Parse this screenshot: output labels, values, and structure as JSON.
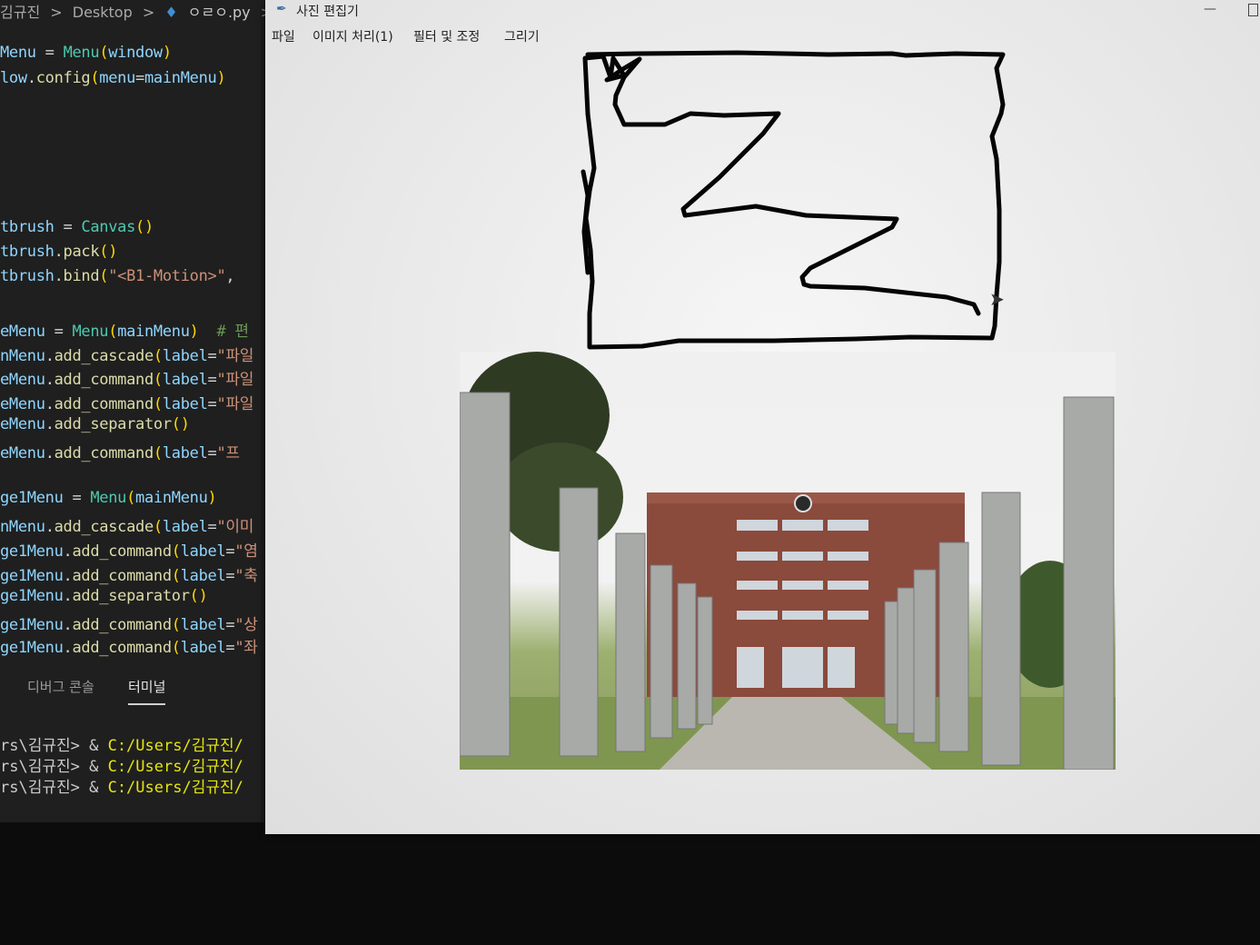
{
  "editor": {
    "breadcrumb": [
      "김규진",
      "Desktop",
      "ㅇㄹㅇ.py"
    ],
    "breadcrumb_sep": ">",
    "code": [
      {
        "tokens": [
          [
            "v",
            "Menu"
          ],
          [
            "t",
            " = "
          ],
          [
            "c",
            "Menu"
          ],
          [
            "p",
            "("
          ],
          [
            "v",
            "window"
          ],
          [
            "p",
            ")"
          ]
        ]
      },
      {
        "tokens": [
          [
            "v",
            "low"
          ],
          [
            "t",
            "."
          ],
          [
            "f",
            "config"
          ],
          [
            "p",
            "("
          ],
          [
            "v",
            "menu"
          ],
          [
            "t",
            "="
          ],
          [
            "v",
            "mainMenu"
          ],
          [
            "p",
            ")"
          ]
        ]
      },
      {
        "tokens": [
          [
            "v",
            "tbrush"
          ],
          [
            "t",
            " = "
          ],
          [
            "c",
            "Canvas"
          ],
          [
            "p",
            "()"
          ]
        ]
      },
      {
        "tokens": [
          [
            "v",
            "tbrush"
          ],
          [
            "t",
            "."
          ],
          [
            "f",
            "pack"
          ],
          [
            "p",
            "()"
          ]
        ]
      },
      {
        "tokens": [
          [
            "v",
            "tbrush"
          ],
          [
            "t",
            "."
          ],
          [
            "f",
            "bind"
          ],
          [
            "p",
            "("
          ],
          [
            "s",
            "\"<B1-Motion>\""
          ],
          [
            "t",
            ","
          ]
        ]
      },
      {
        "tokens": [
          [
            "v",
            "eMenu"
          ],
          [
            "t",
            " = "
          ],
          [
            "c",
            "Menu"
          ],
          [
            "p",
            "("
          ],
          [
            "v",
            "mainMenu"
          ],
          [
            "p",
            ")"
          ],
          [
            "m",
            "  # 편"
          ]
        ]
      },
      {
        "tokens": [
          [
            "v",
            "nMenu"
          ],
          [
            "t",
            "."
          ],
          [
            "f",
            "add_cascade"
          ],
          [
            "p",
            "("
          ],
          [
            "v",
            "label"
          ],
          [
            "t",
            "="
          ],
          [
            "s",
            "\"파일"
          ]
        ]
      },
      {
        "tokens": [
          [
            "v",
            "eMenu"
          ],
          [
            "t",
            "."
          ],
          [
            "f",
            "add_command"
          ],
          [
            "p",
            "("
          ],
          [
            "v",
            "label"
          ],
          [
            "t",
            "="
          ],
          [
            "s",
            "\"파일"
          ]
        ]
      },
      {
        "tokens": [
          [
            "v",
            "eMenu"
          ],
          [
            "t",
            "."
          ],
          [
            "f",
            "add_command"
          ],
          [
            "p",
            "("
          ],
          [
            "v",
            "label"
          ],
          [
            "t",
            "="
          ],
          [
            "s",
            "\"파일"
          ]
        ]
      },
      {
        "tokens": [
          [
            "v",
            "eMenu"
          ],
          [
            "t",
            "."
          ],
          [
            "f",
            "add_separator"
          ],
          [
            "p",
            "()"
          ]
        ]
      },
      {
        "tokens": [
          [
            "v",
            "eMenu"
          ],
          [
            "t",
            "."
          ],
          [
            "f",
            "add_command"
          ],
          [
            "p",
            "("
          ],
          [
            "v",
            "label"
          ],
          [
            "t",
            "="
          ],
          [
            "s",
            "\"프"
          ]
        ]
      },
      {
        "tokens": [
          [
            "v",
            "ge1Menu"
          ],
          [
            "t",
            " = "
          ],
          [
            "c",
            "Menu"
          ],
          [
            "p",
            "("
          ],
          [
            "v",
            "mainMenu"
          ],
          [
            "p",
            ")"
          ]
        ]
      },
      {
        "tokens": [
          [
            "v",
            "nMenu"
          ],
          [
            "t",
            "."
          ],
          [
            "f",
            "add_cascade"
          ],
          [
            "p",
            "("
          ],
          [
            "v",
            "label"
          ],
          [
            "t",
            "="
          ],
          [
            "s",
            "\"이미"
          ]
        ]
      },
      {
        "tokens": [
          [
            "v",
            "ge1Menu"
          ],
          [
            "t",
            "."
          ],
          [
            "f",
            "add_command"
          ],
          [
            "p",
            "("
          ],
          [
            "v",
            "label"
          ],
          [
            "t",
            "="
          ],
          [
            "s",
            "\"염"
          ]
        ]
      },
      {
        "tokens": [
          [
            "v",
            "ge1Menu"
          ],
          [
            "t",
            "."
          ],
          [
            "f",
            "add_command"
          ],
          [
            "p",
            "("
          ],
          [
            "v",
            "label"
          ],
          [
            "t",
            "="
          ],
          [
            "s",
            "\"축"
          ]
        ]
      },
      {
        "tokens": [
          [
            "v",
            "ge1Menu"
          ],
          [
            "t",
            "."
          ],
          [
            "f",
            "add_separator"
          ],
          [
            "p",
            "()"
          ]
        ]
      },
      {
        "tokens": [
          [
            "v",
            "ge1Menu"
          ],
          [
            "t",
            "."
          ],
          [
            "f",
            "add_command"
          ],
          [
            "p",
            "("
          ],
          [
            "v",
            "label"
          ],
          [
            "t",
            "="
          ],
          [
            "s",
            "\"상"
          ]
        ]
      },
      {
        "tokens": [
          [
            "v",
            "ge1Menu"
          ],
          [
            "t",
            "."
          ],
          [
            "f",
            "add_command"
          ],
          [
            "p",
            "("
          ],
          [
            "v",
            "label"
          ],
          [
            "t",
            "="
          ],
          [
            "s",
            "\"좌"
          ]
        ]
      }
    ],
    "panel_tabs": [
      "디버그 콘솔",
      "터미널"
    ],
    "terminal": [
      {
        "prefix": "rs\\김규진> & ",
        "path": "C:/Users/김규진/"
      },
      {
        "prefix": "rs\\김규진> & ",
        "path": "C:/Users/김규진/"
      },
      {
        "prefix": "rs\\김규진> & ",
        "path": "C:/Users/김규진/"
      }
    ]
  },
  "tk_window": {
    "title": "사진 편집기",
    "minimize": "—",
    "menus": [
      "파일",
      "이미지 처리(1)",
      "필터 및 조정",
      "그리기"
    ],
    "drawing_color": "#050505",
    "photo_subject": "brick building with stone columns"
  },
  "icons": {
    "window": "feather-icon",
    "file": "python-icon",
    "pointer": "mouse-cursor-icon"
  },
  "colors": {
    "editor_bg": "#1f1f1f",
    "variable": "#8fd6ff",
    "function": "#dcdcaa",
    "class": "#4ec9b0",
    "string": "#ce9178",
    "bracket": "#ffd700",
    "terminal_path": "#e5e510",
    "tk_bg": "#ececec"
  }
}
